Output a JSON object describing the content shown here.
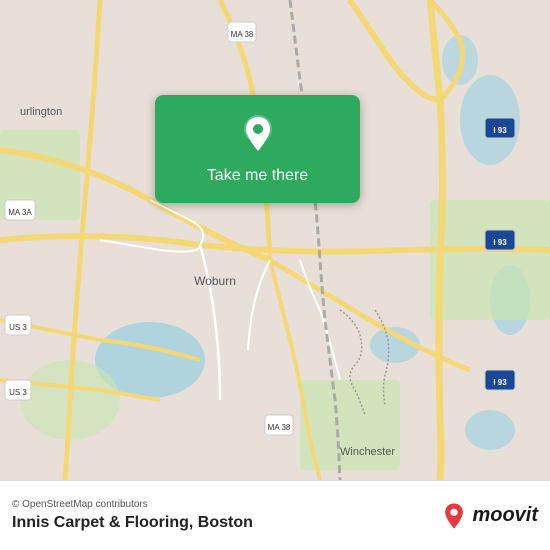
{
  "map": {
    "attribution": "© OpenStreetMap contributors",
    "background_color": "#e8e0d8"
  },
  "popup": {
    "button_label": "Take me there",
    "pin_icon": "location-pin-icon"
  },
  "bottom_bar": {
    "place_name": "Innis Carpet & Flooring, Boston",
    "moovit_label": "moovit"
  }
}
